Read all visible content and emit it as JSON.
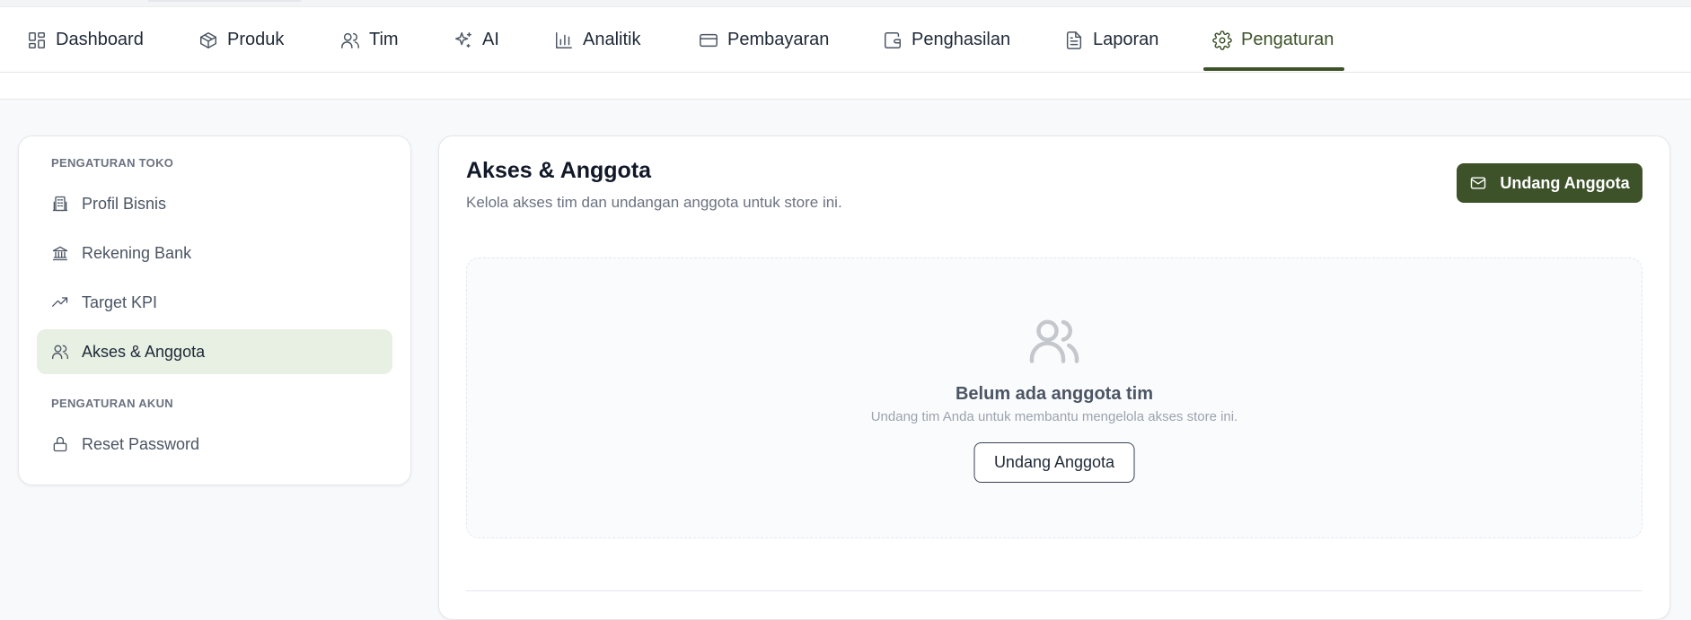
{
  "nav": {
    "items": [
      {
        "label": "Dashboard",
        "icon": "dashboard-icon"
      },
      {
        "label": "Produk",
        "icon": "box-icon"
      },
      {
        "label": "Tim",
        "icon": "users-icon"
      },
      {
        "label": "AI",
        "icon": "sparkles-icon"
      },
      {
        "label": "Analitik",
        "icon": "bar-chart-icon"
      },
      {
        "label": "Pembayaran",
        "icon": "credit-card-icon"
      },
      {
        "label": "Penghasilan",
        "icon": "wallet-icon"
      },
      {
        "label": "Laporan",
        "icon": "document-icon"
      },
      {
        "label": "Pengaturan",
        "icon": "gear-icon",
        "active": true
      }
    ],
    "accent_color": "#3d5229"
  },
  "sidebar": {
    "section_store": "PENGATURAN TOKO",
    "section_account": "PENGATURAN AKUN",
    "items": [
      {
        "label": "Profil Bisnis",
        "icon": "building-icon"
      },
      {
        "label": "Rekening Bank",
        "icon": "bank-icon"
      },
      {
        "label": "Target KPI",
        "icon": "trending-up-icon"
      },
      {
        "label": "Akses & Anggota",
        "icon": "users-icon",
        "active": true
      },
      {
        "label": "Reset Password",
        "icon": "lock-icon"
      }
    ],
    "active_bg": "#e8efe3"
  },
  "main": {
    "title": "Akses & Anggota",
    "subtitle": "Kelola akses tim dan undangan anggota untuk store ini.",
    "invite_button": "Undang Anggota",
    "empty": {
      "title": "Belum ada anggota tim",
      "description": "Undang tim Anda untuk membantu mengelola akses store ini.",
      "button": "Undang Anggota",
      "icon": "users-icon"
    }
  }
}
